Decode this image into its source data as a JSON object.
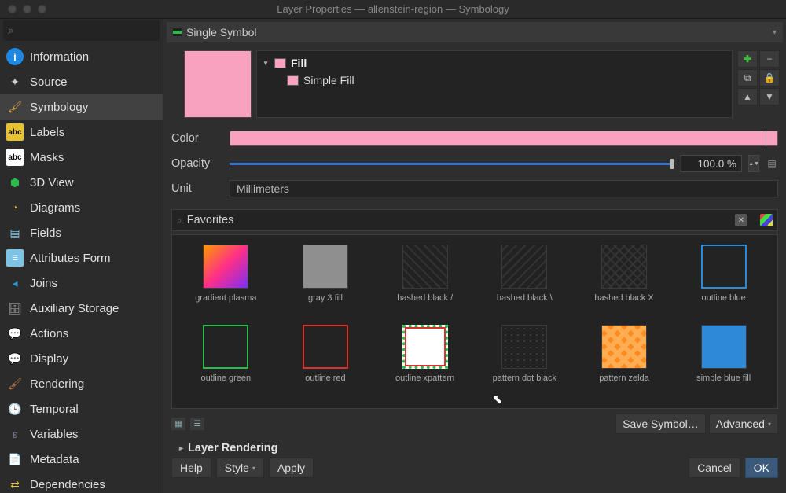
{
  "window": {
    "title": "Layer Properties — allenstein-region — Symbology"
  },
  "sidebar": {
    "search_placeholder": "",
    "items": [
      {
        "label": "Information"
      },
      {
        "label": "Source"
      },
      {
        "label": "Symbology"
      },
      {
        "label": "Labels"
      },
      {
        "label": "Masks"
      },
      {
        "label": "3D View"
      },
      {
        "label": "Diagrams"
      },
      {
        "label": "Fields"
      },
      {
        "label": "Attributes Form"
      },
      {
        "label": "Joins"
      },
      {
        "label": "Auxiliary Storage"
      },
      {
        "label": "Actions"
      },
      {
        "label": "Display"
      },
      {
        "label": "Rendering"
      },
      {
        "label": "Temporal"
      },
      {
        "label": "Variables"
      },
      {
        "label": "Metadata"
      },
      {
        "label": "Dependencies"
      }
    ],
    "active_index": 2
  },
  "symbol_type": "Single Symbol",
  "symbol_tree": {
    "root": {
      "label": "Fill"
    },
    "child": {
      "label": "Simple Fill"
    }
  },
  "preview_color": "#f8a2c0",
  "properties": {
    "color_label": "Color",
    "opacity_label": "Opacity",
    "opacity_value": "100.0 %",
    "unit_label": "Unit",
    "unit_value": "Millimeters"
  },
  "favorites": {
    "label": "Favorites",
    "items": [
      {
        "name": "gradient plasma"
      },
      {
        "name": "gray 3 fill"
      },
      {
        "name": "hashed black /"
      },
      {
        "name": "hashed black \\"
      },
      {
        "name": "hashed black X"
      },
      {
        "name": "outline blue"
      },
      {
        "name": "outline green"
      },
      {
        "name": "outline red"
      },
      {
        "name": "outline xpattern"
      },
      {
        "name": "pattern dot black"
      },
      {
        "name": "pattern zelda"
      },
      {
        "name": "simple blue fill"
      }
    ]
  },
  "layer_rendering_header": "Layer Rendering",
  "buttons": {
    "save_symbol": "Save Symbol…",
    "advanced": "Advanced",
    "help": "Help",
    "style": "Style",
    "apply": "Apply",
    "cancel": "Cancel",
    "ok": "OK"
  }
}
